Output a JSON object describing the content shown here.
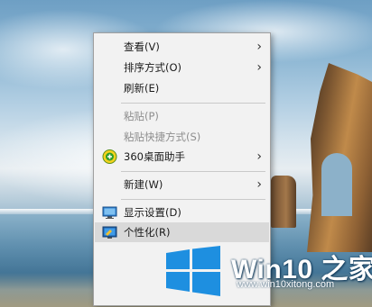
{
  "context_menu": {
    "items": [
      {
        "label": "查看(V)",
        "submenu": true,
        "disabled": false
      },
      {
        "label": "排序方式(O)",
        "submenu": true,
        "disabled": false
      },
      {
        "label": "刷新(E)",
        "submenu": false,
        "disabled": false
      },
      {
        "label": "粘贴(P)",
        "submenu": false,
        "disabled": true
      },
      {
        "label": "粘贴快捷方式(S)",
        "submenu": false,
        "disabled": true
      },
      {
        "label": "360桌面助手",
        "submenu": true,
        "disabled": false,
        "icon": "360-desktop-icon"
      },
      {
        "label": "新建(W)",
        "submenu": true,
        "disabled": false
      },
      {
        "label": "显示设置(D)",
        "submenu": false,
        "disabled": false,
        "icon": "display-settings-icon"
      },
      {
        "label": "个性化(R)",
        "submenu": false,
        "disabled": false,
        "icon": "personalize-icon",
        "hovered": true
      }
    ],
    "submenu_arrow": "›"
  },
  "watermark": {
    "title": "Win10 之家",
    "url": "www.win10xitong.com",
    "logo_icon": "windows-logo-icon",
    "logo_color": "#1e8fe0"
  },
  "colors": {
    "menu_bg": "#f2f2f2",
    "hover_bg": "#d9d9d9",
    "disabled_text": "#8e8e8e"
  }
}
